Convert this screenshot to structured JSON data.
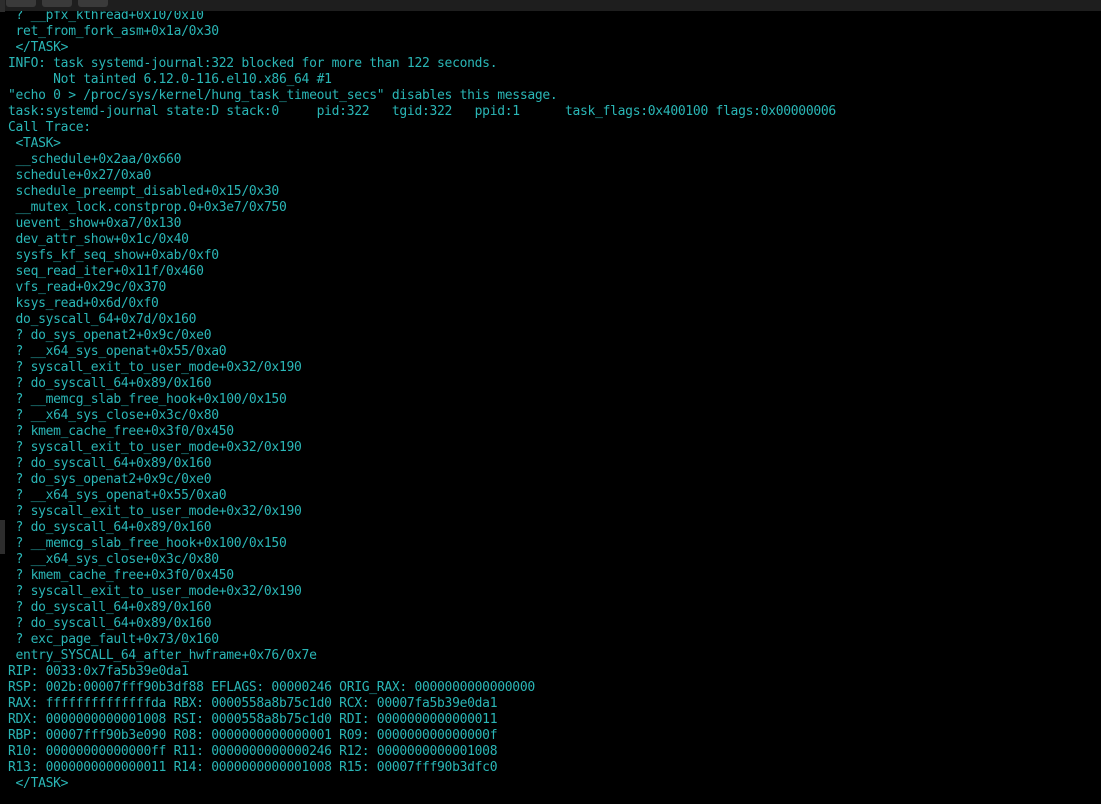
{
  "terminal": {
    "text_color": "#2ab6b6",
    "background": "#000000",
    "lines": [
      " ? __pfx_kthread+0x10/0x10",
      " ret_from_fork_asm+0x1a/0x30",
      " </TASK>",
      "INFO: task systemd-journal:322 blocked for more than 122 seconds.",
      "      Not tainted 6.12.0-116.el10.x86_64 #1",
      "\"echo 0 > /proc/sys/kernel/hung_task_timeout_secs\" disables this message.",
      "task:systemd-journal state:D stack:0     pid:322   tgid:322   ppid:1      task_flags:0x400100 flags:0x00000006",
      "Call Trace:",
      " <TASK>",
      " __schedule+0x2aa/0x660",
      " schedule+0x27/0xa0",
      " schedule_preempt_disabled+0x15/0x30",
      " __mutex_lock.constprop.0+0x3e7/0x750",
      " uevent_show+0xa7/0x130",
      " dev_attr_show+0x1c/0x40",
      " sysfs_kf_seq_show+0xab/0xf0",
      " seq_read_iter+0x11f/0x460",
      " vfs_read+0x29c/0x370",
      " ksys_read+0x6d/0xf0",
      " do_syscall_64+0x7d/0x160",
      " ? do_sys_openat2+0x9c/0xe0",
      " ? __x64_sys_openat+0x55/0xa0",
      " ? syscall_exit_to_user_mode+0x32/0x190",
      " ? do_syscall_64+0x89/0x160",
      " ? __memcg_slab_free_hook+0x100/0x150",
      " ? __x64_sys_close+0x3c/0x80",
      " ? kmem_cache_free+0x3f0/0x450",
      " ? syscall_exit_to_user_mode+0x32/0x190",
      " ? do_syscall_64+0x89/0x160",
      " ? do_sys_openat2+0x9c/0xe0",
      " ? __x64_sys_openat+0x55/0xa0",
      " ? syscall_exit_to_user_mode+0x32/0x190",
      " ? do_syscall_64+0x89/0x160",
      " ? __memcg_slab_free_hook+0x100/0x150",
      " ? __x64_sys_close+0x3c/0x80",
      " ? kmem_cache_free+0x3f0/0x450",
      " ? syscall_exit_to_user_mode+0x32/0x190",
      " ? do_syscall_64+0x89/0x160",
      " ? do_syscall_64+0x89/0x160",
      " ? exc_page_fault+0x73/0x160",
      " entry_SYSCALL_64_after_hwframe+0x76/0x7e",
      "RIP: 0033:0x7fa5b39e0da1",
      "RSP: 002b:00007fff90b3df88 EFLAGS: 00000246 ORIG_RAX: 0000000000000000",
      "RAX: ffffffffffffffda RBX: 0000558a8b75c1d0 RCX: 00007fa5b39e0da1",
      "RDX: 0000000000001008 RSI: 0000558a8b75c1d0 RDI: 0000000000000011",
      "RBP: 00007fff90b3e090 R08: 0000000000000001 R09: 000000000000000f",
      "R10: 00000000000000ff R11: 0000000000000246 R12: 0000000000001008",
      "R13: 0000000000000011 R14: 0000000000001008 R15: 00007fff90b3dfc0",
      " </TASK>"
    ]
  }
}
